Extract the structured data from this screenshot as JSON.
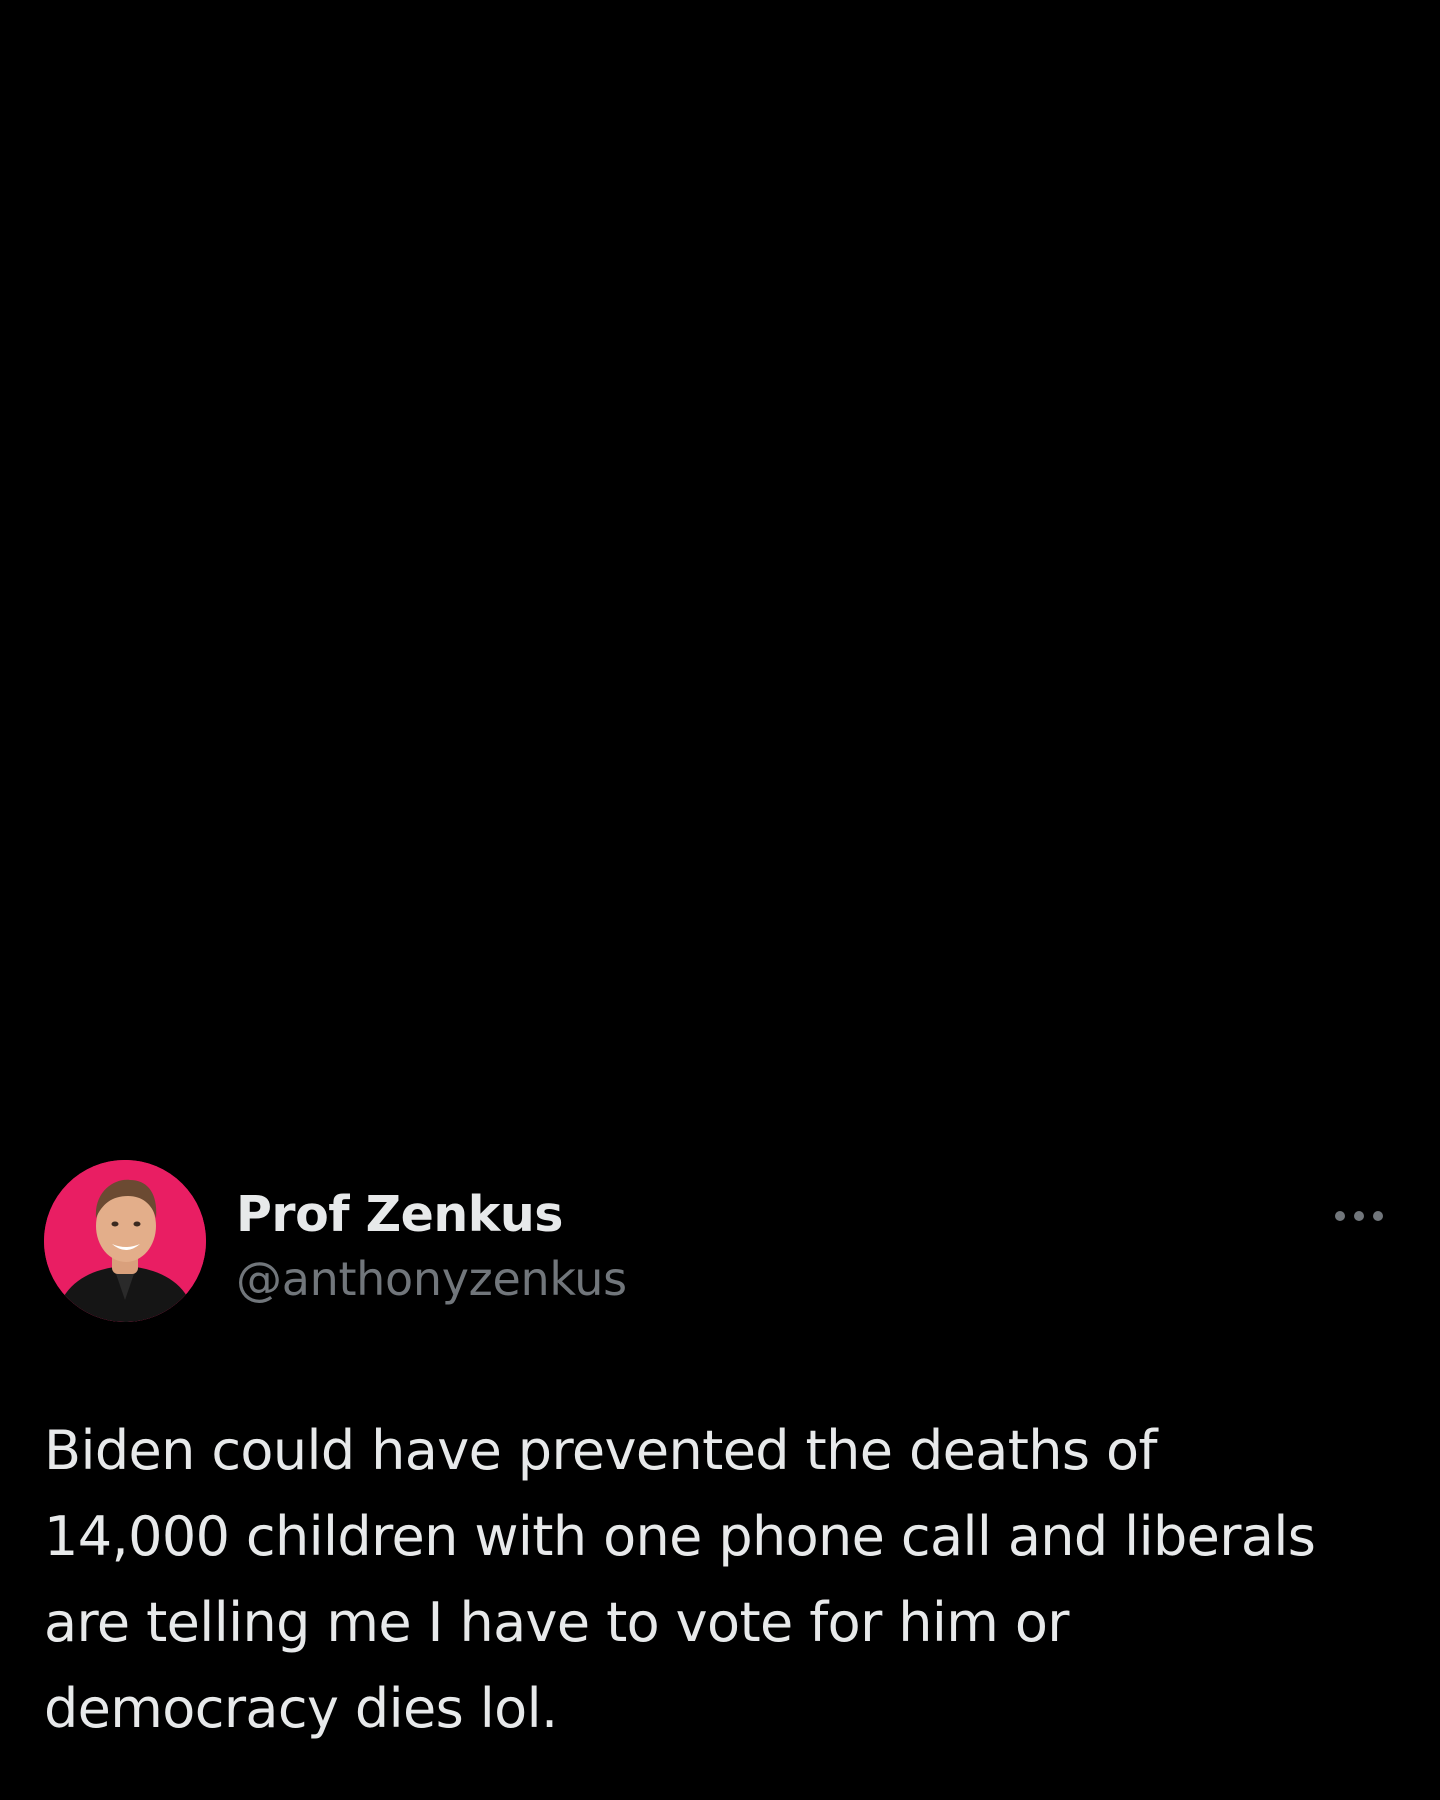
{
  "tweet": {
    "author": {
      "display_name": "Prof Zenkus",
      "handle": "@anthonyzenkus",
      "avatar_icon": "person-photo-icon",
      "avatar_background": "#e91e63"
    },
    "more_icon": "more-horizontal-icon",
    "text": "Biden could have prevented the deaths of\n14,000 children with one phone call and liberals\nare telling me I have to vote for him or\ndemocracy dies lol."
  },
  "colors": {
    "background": "#000000",
    "primary_text": "#e7e9ea",
    "secondary_text": "#71767b"
  }
}
